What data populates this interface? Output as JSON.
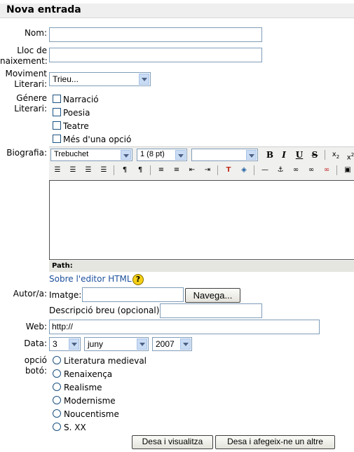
{
  "form_title": "Nova entrada",
  "labels": {
    "nom": "Nom:",
    "lloc_line1": "Lloc de",
    "lloc_line2": "naixement:",
    "moviment_line1": "Moviment",
    "moviment_line2": "Literari:",
    "genere_line1": "Génere",
    "genere_line2": "Literari:",
    "biografia": "Biografia:",
    "autor": "Autor/a:",
    "web": "Web:",
    "data": "Data:",
    "opcio": "opció botó:"
  },
  "moviment_select": "Trieu...",
  "genere_options": [
    "Narració",
    "Poesia",
    "Teatre",
    "Més d'una opció"
  ],
  "editor": {
    "font": "Trebuchet",
    "size": "1 (8 pt)",
    "style": "",
    "path_label": "Path:",
    "help_link": "Sobre l'editor HTML"
  },
  "autor": {
    "imatge_label": "Imatge:",
    "browse_button": "Navega...",
    "desc_label": "Descripció breu (opcional):"
  },
  "web_value": "http://",
  "date": {
    "day": "3",
    "month": "juny",
    "year": "2007"
  },
  "radio_options": [
    "Literatura medieval",
    "Renaixença",
    "Realisme",
    "Modernisme",
    "Noucentisme",
    "S. XX"
  ],
  "buttons": {
    "save_view": "Desa i visualitza",
    "save_add": "Desa i afegeix-ne un altre"
  }
}
